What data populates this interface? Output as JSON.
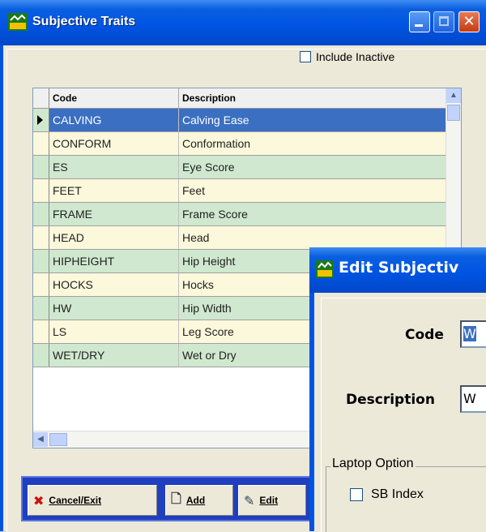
{
  "window": {
    "title": "Subjective Traits"
  },
  "filter": {
    "include_inactive_label": "Include Inactive",
    "include_inactive_checked": false
  },
  "grid": {
    "columns": [
      "Code",
      "Description"
    ],
    "rows": [
      {
        "code": "CALVING",
        "description": "Calving Ease",
        "selected": true
      },
      {
        "code": "CONFORM",
        "description": "Conformation"
      },
      {
        "code": "ES",
        "description": "Eye Score"
      },
      {
        "code": "FEET",
        "description": "Feet"
      },
      {
        "code": "FRAME",
        "description": "Frame Score"
      },
      {
        "code": "HEAD",
        "description": "Head"
      },
      {
        "code": "HIPHEIGHT",
        "description": "Hip Height"
      },
      {
        "code": "HOCKS",
        "description": "Hocks"
      },
      {
        "code": "HW",
        "description": "Hip Width"
      },
      {
        "code": "LS",
        "description": "Leg Score"
      },
      {
        "code": "WET/DRY",
        "description": "Wet or Dry"
      }
    ]
  },
  "toolbar": {
    "cancel_label": "Cancel/Exit",
    "add_label": "Add",
    "edit_label": "Edit"
  },
  "dialog": {
    "title": "Edit Subjectiv",
    "code_label": "Code",
    "code_value": "W",
    "description_label": "Description",
    "description_value": "W",
    "group_label": "Laptop Option",
    "sb_index_label": "SB Index",
    "sb_index_checked": false
  },
  "colors": {
    "titlebar": "#0054e3",
    "row_green": "#cfe8cf",
    "row_yellow": "#fbf8dc",
    "selection": "#3a6fc2",
    "toolbar_bg": "#1f3fbf"
  }
}
